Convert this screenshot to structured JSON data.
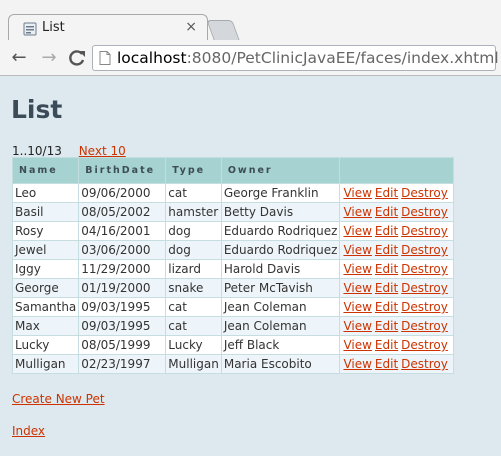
{
  "browser": {
    "tab_title": "List",
    "tab_close_glyph": "×",
    "url_host": "localhost",
    "url_rest": ":8080/PetClinicJavaEE/faces/index.xhtml",
    "back_glyph": "←",
    "forward_glyph": "→",
    "reload_glyph": "C"
  },
  "page": {
    "title": "List",
    "pager_text": "1..10/13",
    "next_label": "Next 10",
    "columns": [
      "Name",
      "BirthDate",
      "Type",
      "Owner",
      ""
    ],
    "action_labels": {
      "view": "View",
      "edit": "Edit",
      "destroy": "Destroy"
    },
    "rows": [
      {
        "name": "Leo",
        "birthdate": "09/06/2000",
        "type": "cat",
        "owner": "George Franklin"
      },
      {
        "name": "Basil",
        "birthdate": "08/05/2002",
        "type": "hamster",
        "owner": "Betty Davis"
      },
      {
        "name": "Rosy",
        "birthdate": "04/16/2001",
        "type": "dog",
        "owner": "Eduardo Rodriquez"
      },
      {
        "name": "Jewel",
        "birthdate": "03/06/2000",
        "type": "dog",
        "owner": "Eduardo Rodriquez"
      },
      {
        "name": "Iggy",
        "birthdate": "11/29/2000",
        "type": "lizard",
        "owner": "Harold Davis"
      },
      {
        "name": "George",
        "birthdate": "01/19/2000",
        "type": "snake",
        "owner": "Peter McTavish"
      },
      {
        "name": "Samantha",
        "birthdate": "09/03/1995",
        "type": "cat",
        "owner": "Jean Coleman"
      },
      {
        "name": "Max",
        "birthdate": "09/03/1995",
        "type": "cat",
        "owner": "Jean Coleman"
      },
      {
        "name": "Lucky",
        "birthdate": "08/05/1999",
        "type": "Lucky",
        "owner": "Jeff Black"
      },
      {
        "name": "Mulligan",
        "birthdate": "02/23/1997",
        "type": "Mulligan",
        "owner": "Maria Escobito"
      }
    ],
    "create_label": "Create New Pet",
    "index_label": "Index"
  },
  "colors": {
    "link": "#cc3300",
    "header_bg": "#a6d2d2",
    "page_bg": "#dde9ee"
  }
}
